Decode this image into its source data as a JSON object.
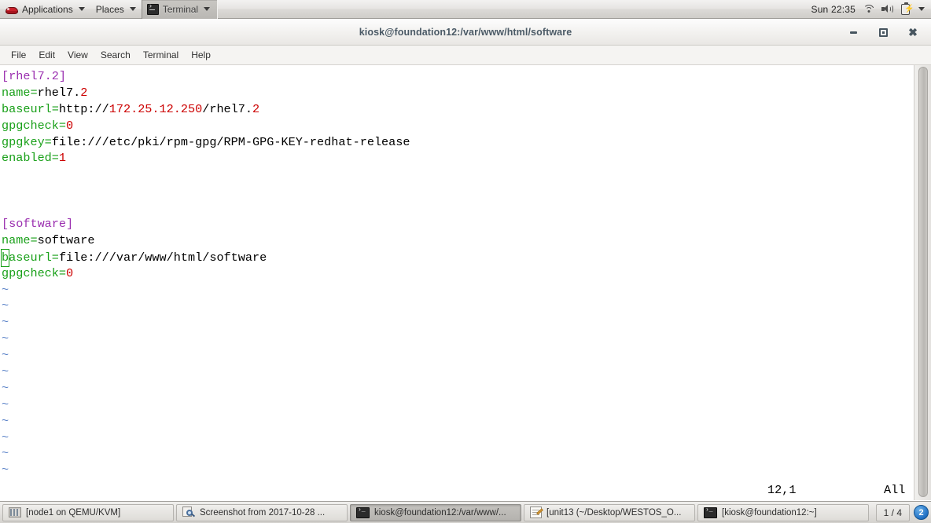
{
  "top_panel": {
    "applications_label": "Applications",
    "places_label": "Places",
    "active_window_label": "Terminal",
    "clock": "Sun 22:35",
    "icons": [
      "redhat-logo-icon",
      "wifi-icon",
      "volume-icon",
      "battery-icon",
      "panel-caret-icon"
    ]
  },
  "window": {
    "title": "kiosk@foundation12:/var/www/html/software",
    "buttons": {
      "minimize": "–",
      "maximize": "□",
      "close": "✖"
    },
    "menus": [
      "File",
      "Edit",
      "View",
      "Search",
      "Terminal",
      "Help"
    ]
  },
  "editor": {
    "lines": [
      {
        "type": "section",
        "text": "[rhel7.2]"
      },
      {
        "type": "kv",
        "key": "name=",
        "parts": [
          {
            "t": "rhel7.",
            "c": "v"
          },
          {
            "t": "2",
            "c": "num"
          }
        ]
      },
      {
        "type": "kv",
        "key": "baseurl=",
        "parts": [
          {
            "t": "http://",
            "c": "v"
          },
          {
            "t": "172.25.12.250",
            "c": "num"
          },
          {
            "t": "/rhel7.",
            "c": "v"
          },
          {
            "t": "2",
            "c": "num"
          }
        ]
      },
      {
        "type": "kv",
        "key": "gpgcheck=",
        "parts": [
          {
            "t": "0",
            "c": "num"
          }
        ]
      },
      {
        "type": "kv",
        "key": "gpgkey=",
        "parts": [
          {
            "t": "file:///etc/pki/rpm-gpg/RPM-GPG-KEY-redhat-release",
            "c": "v"
          }
        ]
      },
      {
        "type": "kv",
        "key": "enabled=",
        "parts": [
          {
            "t": "1",
            "c": "num"
          }
        ]
      },
      {
        "type": "blank",
        "text": ""
      },
      {
        "type": "blank",
        "text": ""
      },
      {
        "type": "blank",
        "text": ""
      },
      {
        "type": "section",
        "text": "[software]"
      },
      {
        "type": "kv",
        "key": "name=",
        "parts": [
          {
            "t": "software",
            "c": "v"
          }
        ]
      },
      {
        "type": "cursorline",
        "cursor_char": "b",
        "key_rest": "aseurl=",
        "parts": [
          {
            "t": "file:///var/www/html/software",
            "c": "v"
          }
        ]
      },
      {
        "type": "kv",
        "key": "gpgcheck=",
        "parts": [
          {
            "t": "0",
            "c": "num"
          }
        ]
      }
    ],
    "tilde_count": 12,
    "tilde_char": "~",
    "status": {
      "ruler": "12,1",
      "scroll_pos": "All"
    }
  },
  "taskbar": {
    "items": [
      {
        "label": "[node1 on QEMU/KVM]",
        "icon": "vm-display-icon",
        "active": false
      },
      {
        "label": "Screenshot from 2017-10-28 ...",
        "icon": "screenshot-viewer-icon",
        "active": false
      },
      {
        "label": "kiosk@foundation12:/var/www/...",
        "icon": "terminal-icon",
        "active": true
      },
      {
        "label": "[unit13 (~/Desktop/WESTOS_O...",
        "icon": "text-editor-icon",
        "active": false
      },
      {
        "label": "[kiosk@foundation12:~]",
        "icon": "terminal-icon",
        "active": false
      }
    ],
    "pager": "1 / 4",
    "workspace": "2"
  },
  "colors": {
    "key_green": "#19a019",
    "value_black": "#000000",
    "number_red": "#cc0000",
    "section_purple": "#9b30b0",
    "tilde_blue": "#5b83c8",
    "cursor_green": "#19a019",
    "terminal_bg": "#ffffff",
    "panel_grey": "#dcdad7",
    "title_text": "#4b5a66",
    "workspace_blue": "#1f6fc4"
  }
}
